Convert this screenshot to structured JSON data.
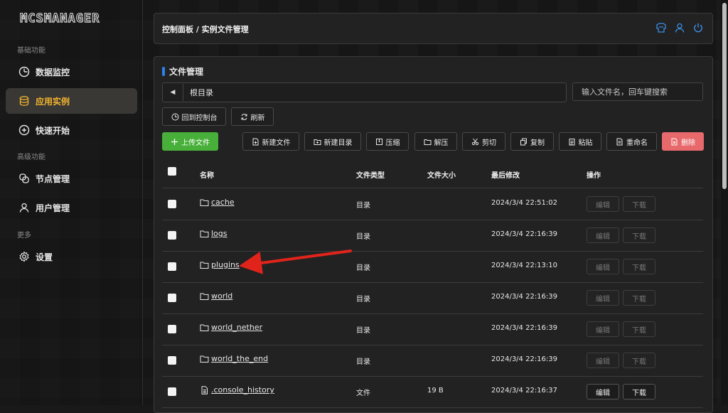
{
  "app": {
    "logo": "MCSMANAGER"
  },
  "sidebar": {
    "sections": [
      {
        "label": "基础功能"
      },
      {
        "label": "高级功能"
      },
      {
        "label": "更多"
      }
    ],
    "items": [
      {
        "label": "数据监控",
        "icon": "dashboard-icon"
      },
      {
        "label": "应用实例",
        "icon": "database-icon",
        "active": true
      },
      {
        "label": "快速开始",
        "icon": "plus-circle-icon"
      },
      {
        "label": "节点管理",
        "icon": "nodes-icon"
      },
      {
        "label": "用户管理",
        "icon": "user-icon"
      },
      {
        "label": "设置",
        "icon": "gear-icon"
      }
    ]
  },
  "header": {
    "breadcrumb": "控制面板 / 实例文件管理",
    "icons": [
      "shirt-icon",
      "user-icon",
      "power-icon"
    ]
  },
  "panel": {
    "title": "文件管理",
    "path": "根目录",
    "search_placeholder": "输入文件名，回车键搜索",
    "back_to_console": "回到控制台",
    "refresh": "刷新",
    "toolbar": {
      "upload": "上传文件",
      "new_file": "新建文件",
      "new_dir": "新建目录",
      "compress": "压缩",
      "extract": "解压",
      "cut": "剪切",
      "copy": "复制",
      "paste": "粘贴",
      "rename": "重命名",
      "delete": "删除"
    },
    "columns": {
      "name": "名称",
      "type": "文件类型",
      "size": "文件大小",
      "modified": "最后修改",
      "actions": "操作"
    },
    "actions": {
      "edit": "编辑",
      "download": "下载"
    },
    "rows": [
      {
        "name": "cache",
        "type": "目录",
        "size": "",
        "modified": "2024/3/4 22:51:02",
        "is_dir": true
      },
      {
        "name": "logs",
        "type": "目录",
        "size": "",
        "modified": "2024/3/4 22:16:39",
        "is_dir": true
      },
      {
        "name": "plugins",
        "type": "目录",
        "size": "",
        "modified": "2024/3/4 22:13:10",
        "is_dir": true
      },
      {
        "name": "world",
        "type": "目录",
        "size": "",
        "modified": "2024/3/4 22:16:39",
        "is_dir": true
      },
      {
        "name": "world_nether",
        "type": "目录",
        "size": "",
        "modified": "2024/3/4 22:16:39",
        "is_dir": true
      },
      {
        "name": "world_the_end",
        "type": "目录",
        "size": "",
        "modified": "2024/3/4 22:16:39",
        "is_dir": true
      },
      {
        "name": ".console_history",
        "type": "文件",
        "size": "19 B",
        "modified": "2024/3/4 22:16:37",
        "is_dir": false
      }
    ]
  },
  "annotation": {
    "color": "#e0241b",
    "target": "plugins"
  },
  "colors": {
    "accent": "#f0b230",
    "upload": "#48b03a",
    "delete": "#e8696b",
    "title_bar": "#2f80ed",
    "header_icons": "#3a8ee6"
  }
}
